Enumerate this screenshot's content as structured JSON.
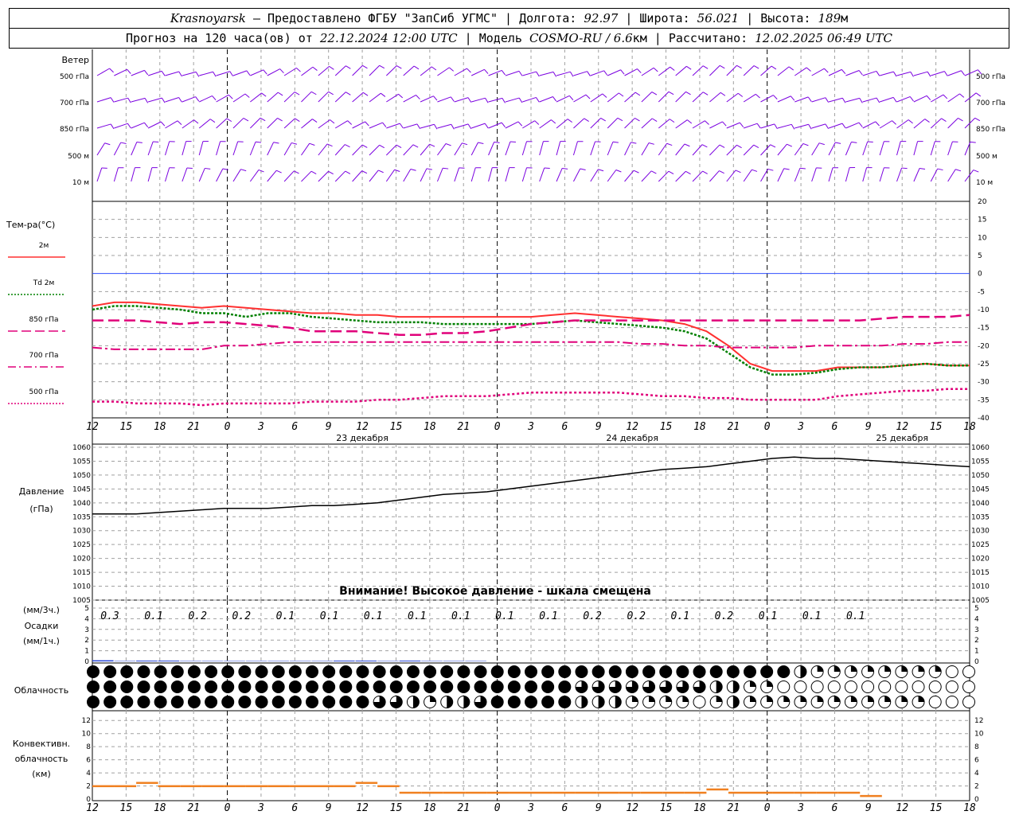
{
  "header": {
    "station": "Krasnoyarsk",
    "provider": "— Предоставлено ФГБУ \"ЗапСиб УГМС\"",
    "lon_label": "| Долгота:",
    "lon": "92.97",
    "lat_label": "| Широта:",
    "lat": "56.021",
    "alt_label": "| Высота:",
    "alt": "189",
    "alt_unit": "м",
    "forecast_label": "Прогноз на 120 часа(ов) от",
    "forecast_start": "22.12.2024 12:00 UTC",
    "model_label": "| Модель",
    "model": "COSMO-RU / 6.6",
    "model_unit": "км",
    "calc_label": "| Рассчитано:",
    "calc_time": "12.02.2025 06:49 UTC"
  },
  "colors": {
    "t2m": "#ff3030",
    "td2m": "#008000",
    "t850": "#e0007a",
    "t700": "#e0007a",
    "t500": "#e0007a",
    "wind": "#7a00e0",
    "pressure": "#000000",
    "precip": "#1f3fd6",
    "convective": "#f08020",
    "zero_line": "#3050ff",
    "grid": "#a0a0a0"
  },
  "time_axis": {
    "ticks": [
      "12",
      "15",
      "18",
      "21",
      "0",
      "3",
      "6",
      "9",
      "12",
      "15",
      "18",
      "21",
      "0",
      "3",
      "6",
      "9",
      "12",
      "15",
      "18",
      "21",
      "0",
      "3",
      "6",
      "9",
      "12",
      "15",
      "18"
    ],
    "day_labels": [
      {
        "text": "23 декабря",
        "tick_index": 8
      },
      {
        "text": "24 декабря",
        "tick_index": 16
      },
      {
        "text": "25 декабря",
        "tick_index": 24
      }
    ]
  },
  "wind_panel": {
    "title": "Ветер",
    "levels": [
      "500 гПа",
      "700 гПа",
      "850 гПа",
      "500 м",
      "10 м"
    ],
    "icon": "wind-barb-icon"
  },
  "temp_panel": {
    "title": "Тем-ра(°C)",
    "legend": [
      {
        "label": "2м",
        "style": "solid",
        "color": "#ff3030"
      },
      {
        "label": "Td 2м",
        "style": "dotted",
        "color": "#008000"
      },
      {
        "label": "850 гПа",
        "style": "longdash",
        "color": "#e0007a"
      },
      {
        "label": "700 гПа",
        "style": "dashdot",
        "color": "#e0007a"
      },
      {
        "label": "500 гПа",
        "style": "dotted",
        "color": "#e0007a"
      }
    ],
    "yticks": [
      20,
      15,
      10,
      5,
      0,
      -5,
      -10,
      -15,
      -20,
      -25,
      -30,
      -35,
      -40
    ]
  },
  "pressure_panel": {
    "title": "Давление",
    "unit": "(гПа)",
    "warning": "Внимание! Высокое давление - шкала смещена",
    "yticks": [
      1060,
      1055,
      1050,
      1045,
      1040,
      1035,
      1030,
      1025,
      1020,
      1015,
      1010,
      1005
    ]
  },
  "precip_panel": {
    "unit3h": "(мм/3ч.)",
    "title": "Осадки",
    "unit1h": "(мм/1ч.)",
    "yticks": [
      5,
      4,
      3,
      2,
      1,
      0
    ],
    "values_3h": [
      "0.3",
      "0.1",
      "0.2",
      "0.2",
      "0.1",
      "0.1",
      "0.1",
      "0.1",
      "0.1",
      "0.1",
      "0.1",
      "0.2",
      "0.2",
      "0.1",
      "0.2",
      "0.1",
      "0.1",
      "0.1"
    ]
  },
  "cloud_panel": {
    "title": "Облачность",
    "icon": "cloud-cover-icon"
  },
  "conv_panel": {
    "title_lines": [
      "Конвективн.",
      "облачность",
      "(км)"
    ],
    "yticks": [
      12,
      10,
      8,
      6,
      4,
      2,
      0
    ]
  },
  "chart_data": {
    "type": "line",
    "x": [
      0,
      3,
      6,
      9,
      12,
      15,
      18,
      21,
      24,
      27,
      30,
      33,
      36,
      39,
      42,
      45,
      48,
      51,
      54,
      57,
      60,
      63,
      66,
      69,
      72,
      75,
      78,
      81,
      84,
      87,
      90,
      93,
      96,
      99,
      102,
      105,
      108,
      111,
      114,
      117,
      120
    ],
    "x_unit": "hours since 22.12.2024 12:00 UTC",
    "temperature": {
      "ylim": [
        -40,
        20
      ],
      "series": [
        {
          "name": "2м",
          "values": [
            -9,
            -8,
            -8,
            -8.5,
            -9,
            -9.5,
            -9,
            -9.5,
            -10,
            -10.5,
            -11,
            -11,
            -11.5,
            -11.5,
            -12,
            -12,
            -12,
            -12,
            -12,
            -12,
            -12,
            -11.5,
            -11,
            -11.5,
            -12,
            -12.5,
            -13,
            -14,
            -16,
            -20,
            -25,
            -27,
            -27,
            -27,
            -26,
            -26,
            -26,
            -25.5,
            -25,
            -25.5,
            -25.5
          ]
        },
        {
          "name": "Td 2м",
          "values": [
            -10,
            -9,
            -9,
            -9.5,
            -10,
            -11,
            -11,
            -12,
            -11,
            -11,
            -12,
            -12.5,
            -13,
            -13.5,
            -13.5,
            -13.5,
            -14,
            -14,
            -14,
            -14,
            -14,
            -13.5,
            -13,
            -13.5,
            -14,
            -14.5,
            -15,
            -16,
            -18,
            -22,
            -26,
            -28,
            -28,
            -27.5,
            -26.5,
            -26,
            -26,
            -25.5,
            -25,
            -25.5,
            -25.5
          ]
        },
        {
          "name": "850 гПа",
          "values": [
            -13,
            -13,
            -13,
            -13.5,
            -14,
            -13.5,
            -13.5,
            -14,
            -14.5,
            -15,
            -16,
            -16,
            -16,
            -16.5,
            -17,
            -17,
            -16.5,
            -16.5,
            -16,
            -15,
            -14,
            -13.5,
            -13,
            -13,
            -13,
            -13,
            -13,
            -13,
            -13,
            -13,
            -13,
            -13,
            -13,
            -13,
            -13,
            -13,
            -12.5,
            -12,
            -12,
            -12,
            -11.5
          ]
        },
        {
          "name": "700 гПа",
          "values": [
            -20.5,
            -21,
            -21,
            -21,
            -21,
            -21,
            -20,
            -20,
            -19.5,
            -19,
            -19,
            -19,
            -19,
            -19,
            -19,
            -19,
            -19,
            -19,
            -19,
            -19,
            -19,
            -19,
            -19,
            -19,
            -19,
            -19.5,
            -19.5,
            -20,
            -20,
            -20.5,
            -20.5,
            -20.5,
            -20.5,
            -20,
            -20,
            -20,
            -20,
            -19.5,
            -19.5,
            -19,
            -19
          ]
        },
        {
          "name": "500 гПа",
          "values": [
            -35.5,
            -35.5,
            -36,
            -36,
            -36,
            -36.5,
            -36,
            -36,
            -36,
            -36,
            -35.5,
            -35.5,
            -35.5,
            -35,
            -35,
            -34.5,
            -34,
            -34,
            -34,
            -33.5,
            -33,
            -33,
            -33,
            -33,
            -33,
            -33.5,
            -34,
            -34,
            -34.5,
            -34.5,
            -35,
            -35,
            -35,
            -35,
            -34,
            -33.5,
            -33,
            -32.5,
            -32.5,
            -32,
            -32
          ]
        }
      ]
    },
    "pressure": {
      "ylim": [
        1005,
        1060
      ],
      "values": [
        1036,
        1036,
        1036,
        1036.5,
        1037,
        1037.5,
        1038,
        1038,
        1038,
        1038.5,
        1039,
        1039,
        1039.5,
        1040,
        1041,
        1042,
        1043,
        1043.5,
        1044,
        1045,
        1046,
        1047,
        1048,
        1049,
        1050,
        1051,
        1052,
        1052.5,
        1053,
        1054,
        1055,
        1056,
        1056.5,
        1056,
        1056,
        1055.5,
        1055,
        1054.5,
        1054,
        1053.5,
        1053
      ]
    },
    "precip_1h": {
      "ylim": [
        0,
        5
      ],
      "values": [
        0.3,
        0.1,
        0.2,
        0.2,
        0.1,
        0.1,
        0.1,
        0.1,
        0.1,
        0.1,
        0.1,
        0.2,
        0.2,
        0.1,
        0.2,
        0.1,
        0.1,
        0.1,
        0,
        0,
        0,
        0,
        0,
        0,
        0,
        0,
        0,
        0,
        0,
        0,
        0,
        0,
        0,
        0,
        0,
        0,
        0,
        0,
        0,
        0,
        0
      ]
    },
    "convective_km": {
      "ylim": [
        0,
        13
      ],
      "values": [
        2,
        2,
        2.5,
        2,
        2,
        2,
        2,
        2,
        2,
        2,
        2,
        2,
        2.5,
        2,
        1,
        1,
        1,
        1,
        1,
        1,
        1,
        1,
        1,
        1,
        1,
        1,
        1,
        1,
        1.5,
        1,
        1,
        1,
        1,
        1,
        1,
        0.5,
        0,
        0,
        0,
        0,
        0
      ]
    },
    "cloud_cover_octas": {
      "low": [
        8,
        8,
        8,
        8,
        8,
        8,
        8,
        8,
        8,
        8,
        8,
        8,
        8,
        6,
        4,
        2,
        4,
        6,
        8,
        8,
        8,
        8,
        4,
        4,
        2,
        2,
        2,
        0,
        2,
        4,
        2,
        2,
        2,
        2,
        2,
        2,
        2,
        2,
        0,
        0,
        0
      ],
      "mid": [
        8,
        8,
        8,
        8,
        8,
        8,
        8,
        8,
        8,
        8,
        8,
        8,
        8,
        8,
        8,
        8,
        8,
        8,
        8,
        8,
        8,
        8,
        6,
        6,
        6,
        6,
        6,
        6,
        4,
        4,
        2,
        0,
        0,
        0,
        0,
        0,
        0,
        0,
        0,
        0,
        0
      ],
      "high": [
        8,
        8,
        8,
        8,
        8,
        8,
        8,
        8,
        8,
        8,
        8,
        8,
        8,
        8,
        8,
        8,
        8,
        8,
        8,
        8,
        8,
        8,
        8,
        8,
        8,
        8,
        8,
        8,
        8,
        8,
        8,
        8,
        4,
        2,
        2,
        2,
        2,
        2,
        2,
        0,
        0
      ]
    }
  }
}
